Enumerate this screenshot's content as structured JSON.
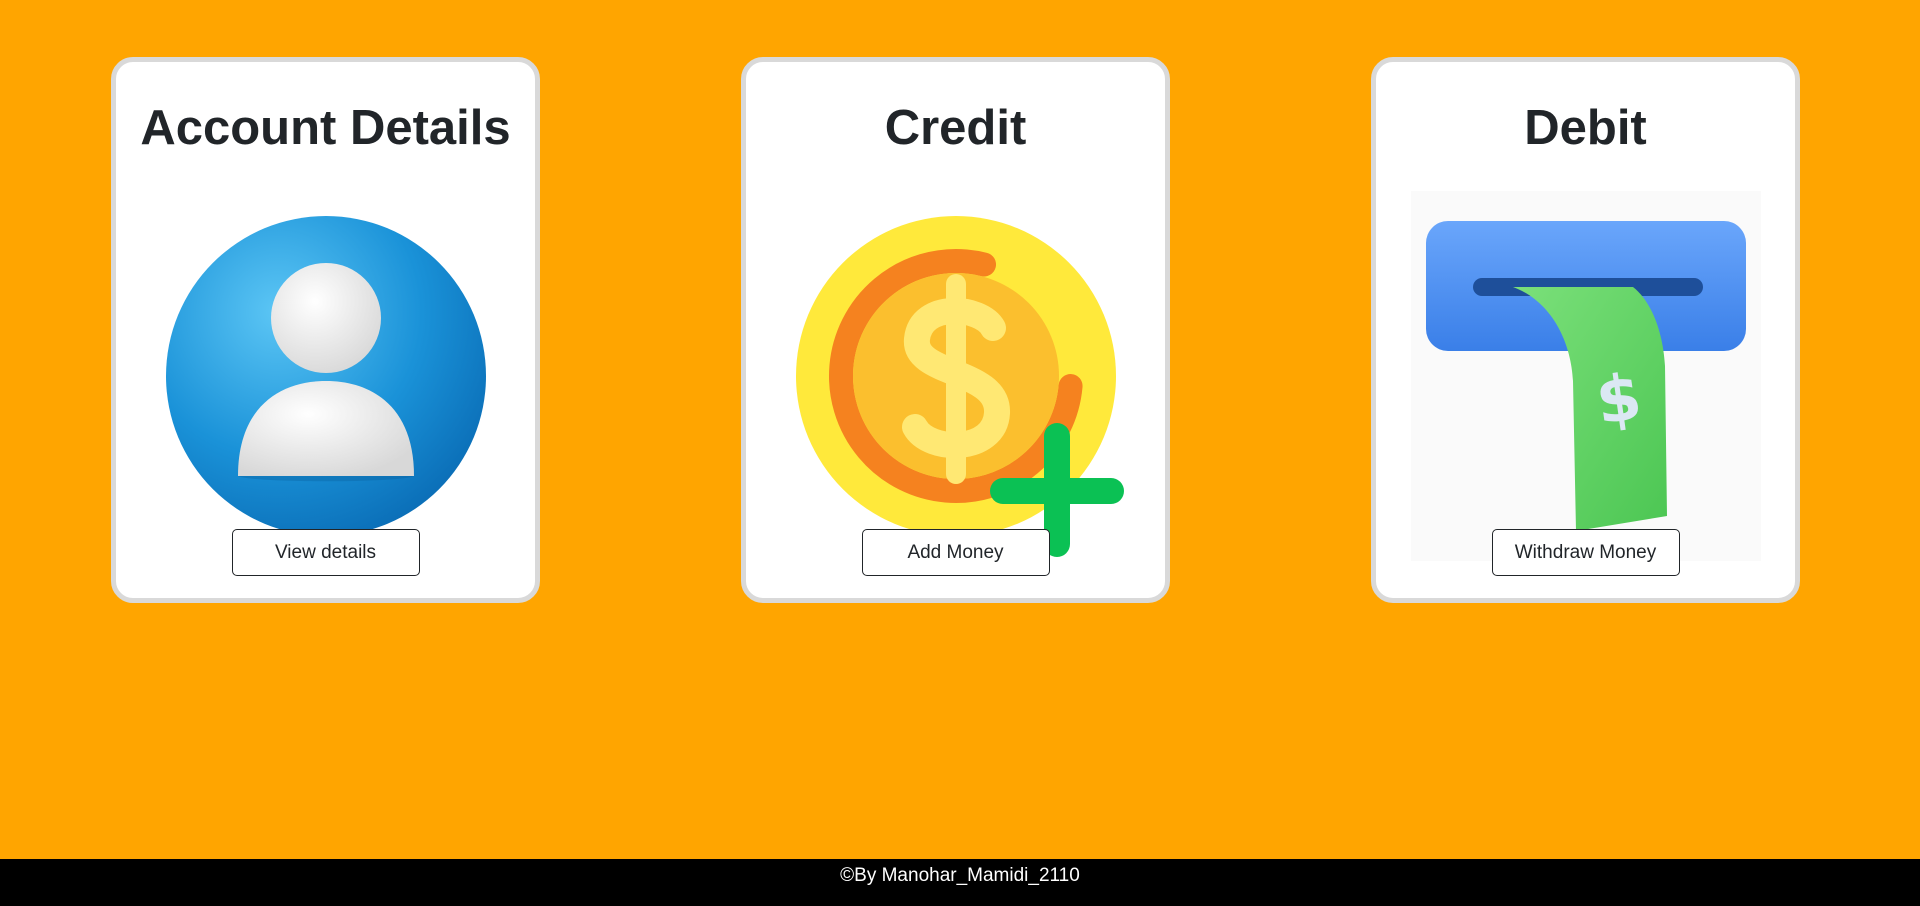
{
  "cards": [
    {
      "title": "Account Details",
      "button_label": "View details",
      "icon": "user-avatar-icon",
      "icon_colors": {
        "circle": "#1a92d8",
        "figure": "#eeeeee"
      }
    },
    {
      "title": "Credit",
      "button_label": "Add Money",
      "icon": "coin-plus-icon",
      "icon_colors": {
        "outer": "#ffe93b",
        "ring": "#f5821f",
        "inner": "#fbbf2e",
        "plus": "#0bc154"
      }
    },
    {
      "title": "Debit",
      "button_label": "Withdraw Money",
      "icon": "atm-cash-withdraw-icon",
      "icon_colors": {
        "slot": "#4b8ef3",
        "bill": "#5fd161"
      }
    }
  ],
  "footer": {
    "text": "©By Manohar_Mamidi_2110"
  },
  "colors": {
    "background": "#FFA500",
    "footer_bg": "#000000"
  }
}
